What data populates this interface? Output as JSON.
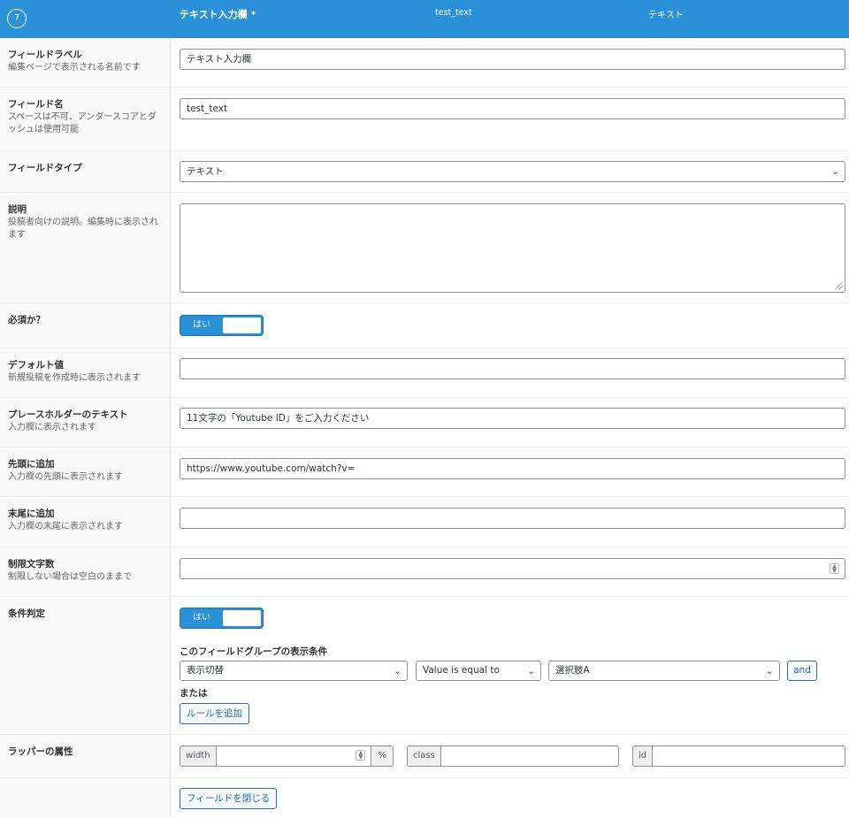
{
  "header": {
    "order": "7",
    "label": "テキスト入力欄 *",
    "name": "test_text",
    "type": "テキスト"
  },
  "rows": {
    "label": {
      "title": "フィールドラベル",
      "desc": "編集ページで表示される名前です",
      "value": "テキスト入力欄"
    },
    "name": {
      "title": "フィールド名",
      "desc": "スペースは不可、アンダースコアとダッシュは使用可能",
      "value": "test_text"
    },
    "type": {
      "title": "フィールドタイプ",
      "value": "テキスト"
    },
    "instructions": {
      "title": "説明",
      "desc": "投稿者向けの説明。編集時に表示されます",
      "value": ""
    },
    "required": {
      "title": "必須か？",
      "toggle_label": "はい"
    },
    "default": {
      "title": "デフォルト値",
      "desc": "新規投稿を作成時に表示されます",
      "value": ""
    },
    "placeholder": {
      "title": "プレースホルダーのテキスト",
      "desc": "入力欄に表示されます",
      "value": "11文字の「Youtube ID」をご入力ください"
    },
    "prepend": {
      "title": "先頭に追加",
      "desc": "入力欄の先頭に表示されます",
      "value": "https://www.youtube.com/watch?v="
    },
    "append": {
      "title": "末尾に追加",
      "desc": "入力欄の末尾に表示されます",
      "value": ""
    },
    "maxlength": {
      "title": "制限文字数",
      "desc": "制限しない場合は空白のままで",
      "value": ""
    },
    "conditional": {
      "title": "条件判定",
      "toggle_label": "はい",
      "group_title": "このフィールドグループの表示条件",
      "rule": {
        "field": "表示切替",
        "operator": "Value is equal to",
        "value": "選択肢A"
      },
      "and_label": "and",
      "or_label": "または",
      "add_rule_label": "ルールを追加"
    },
    "wrapper": {
      "title": "ラッパーの属性",
      "width_label": "width",
      "width_unit": "%",
      "class_label": "class",
      "id_label": "id"
    }
  },
  "close_button": "フィールドを閉じる"
}
